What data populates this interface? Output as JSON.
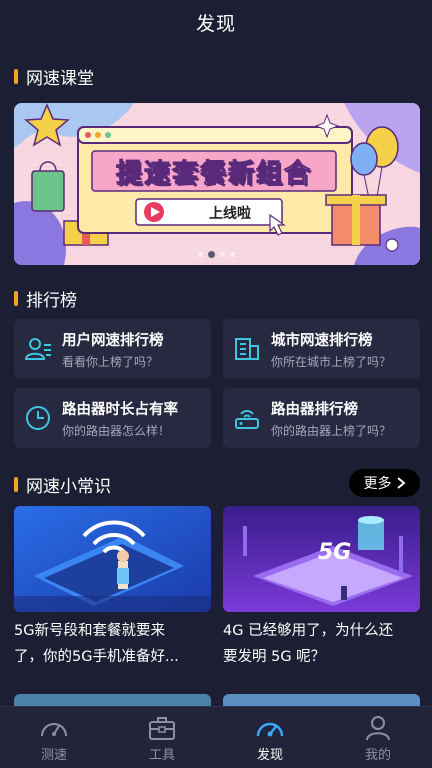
{
  "header": {
    "title": "发现"
  },
  "sections": {
    "course": "网速课堂",
    "ranking": "排行榜",
    "tips": "网速小常识"
  },
  "banner": {
    "title": "提速套餐新组合",
    "subtitle": "上线啦"
  },
  "ranking": [
    {
      "title": "用户网速排行榜",
      "subtitle": "看看你上榜了吗？",
      "icon": "user-list-icon"
    },
    {
      "title": "城市网速排行榜",
      "subtitle": "你所在城市上榜了吗？",
      "icon": "city-building-icon"
    },
    {
      "title": "路由器时长占有率",
      "subtitle": "你的路由器怎么样！",
      "icon": "clock-icon"
    },
    {
      "title": "路由器排行榜",
      "subtitle": "你的路由器上榜了吗？",
      "icon": "router-icon"
    }
  ],
  "more": {
    "label": "更多"
  },
  "articles": [
    {
      "line1": "5G新号段和套餐就要来",
      "line2": "了，你的5G手机准备好..."
    },
    {
      "line1": "4G 已经够用了，为什么还",
      "line2": "要发明 5G 呢？",
      "image_text": "5G"
    }
  ],
  "tabs": [
    {
      "label": "测速",
      "icon": "speedometer-icon",
      "active": false
    },
    {
      "label": "工具",
      "icon": "toolbox-icon",
      "active": false
    },
    {
      "label": "发现",
      "icon": "discover-gauge-icon",
      "active": true
    },
    {
      "label": "我的",
      "icon": "person-icon",
      "active": false
    }
  ],
  "colors": {
    "background": "#1c1e33",
    "card": "#262940",
    "accent_bar": "#f5a623",
    "icon_cyan": "#3ec6e0",
    "active_tab": "#3aa7ff"
  }
}
